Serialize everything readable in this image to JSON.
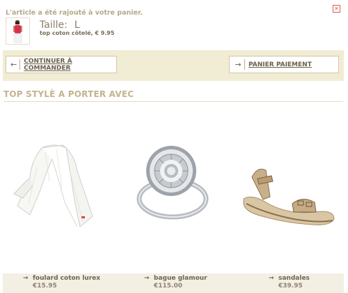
{
  "notice": {
    "message": "L'article a été rajouté à votre panier.",
    "close_glyph": "✕"
  },
  "added_item": {
    "size_label": "Taille:",
    "size_value": "L",
    "description": "top coton côtelé, € 9.95"
  },
  "actions": {
    "continue_label": "CONTINUER À COMMANDER",
    "continue_icon": "arrow-left-icon",
    "pay_label": "PANIER PAIEMENT",
    "pay_icon": "arrow-right-icon"
  },
  "section": {
    "title": "TOP STYLÈ  A PORTER AVEC"
  },
  "products": [
    {
      "name": "foulard coton lurex",
      "price": "€15.95",
      "image": "scarf-image"
    },
    {
      "name": "bague glamour",
      "price": "€115.00",
      "image": "ring-image"
    },
    {
      "name": "sandales",
      "price": "€39.95",
      "image": "sandals-image"
    }
  ],
  "colors": {
    "accent_bar": "#f1ecd4",
    "section_title": "#c2b48f",
    "close_red": "#d85a4a"
  }
}
